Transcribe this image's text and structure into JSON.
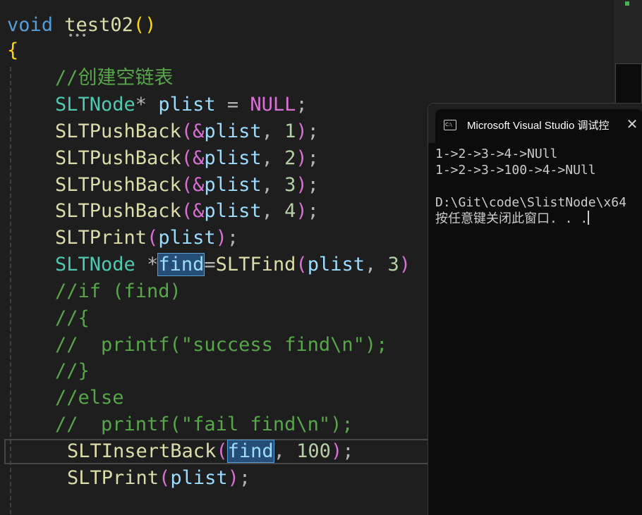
{
  "editor": {
    "signature": {
      "keyword": "void",
      "name": "test02",
      "parens": "()"
    },
    "open_brace": "{",
    "code": {
      "comment_create": "//创建空链表",
      "decl": {
        "type": "SLTNode",
        "star": "*",
        "var": "plist",
        "op": "=",
        "value": "NULL",
        "semi": ";"
      },
      "push1": {
        "fn": "SLTPushBack",
        "amp": "(&",
        "var": "plist",
        "comma": ",",
        "num": "1",
        "close": ")",
        "semi": ";"
      },
      "push2": {
        "fn": "SLTPushBack",
        "amp": "(&",
        "var": "plist",
        "comma": ",",
        "num": "2",
        "close": ")",
        "semi": ";"
      },
      "push3": {
        "fn": "SLTPushBack",
        "amp": "(&",
        "var": "plist",
        "comma": ",",
        "num": "3",
        "close": ")",
        "semi": ";"
      },
      "push4": {
        "fn": "SLTPushBack",
        "amp": "(&",
        "var": "plist",
        "comma": ",",
        "num": "4",
        "close": ")",
        "semi": ";"
      },
      "print1": {
        "fn": "SLTPrint",
        "open": "(",
        "var": "plist",
        "close": ")",
        "semi": ";"
      },
      "find": {
        "type": "SLTNode",
        "star": "*",
        "var": "find",
        "op": "=",
        "fn": "SLTFind",
        "open": "(",
        "arg": "plist",
        "comma": ",",
        "num": "3",
        "close": ")"
      },
      "c_if": "//if (find)",
      "c_open": "//{",
      "c_printf_success": "//  printf(\"success find\\n\");",
      "c_close": "//}",
      "c_else": "//else",
      "c_printf_fail": "//  printf(\"fail find\\n\");",
      "insert": {
        "fn": "SLTInsertBack",
        "open": "(",
        "var": "find",
        "comma": ",",
        "num": "100",
        "close": ")",
        "semi": ";"
      },
      "print2": {
        "fn": "SLTPrint",
        "open": "(",
        "var": "plist",
        "close": ")",
        "semi": ";"
      }
    }
  },
  "console": {
    "icon": "C:\\",
    "title": "Microsoft Visual Studio 调试控",
    "close": "✕",
    "lines": [
      "1->2->3->4->NUll",
      "1->2->3->100->4->NUll",
      "",
      "D:\\Git\\code\\SlistNode\\x64",
      "按任意键关闭此窗口. . ."
    ]
  },
  "colors": {
    "background": "#1e1e1e",
    "keyword": "#569cd6",
    "function": "#dcdcaa",
    "type": "#4ec9b0",
    "variable": "#9cdcfe",
    "number": "#b5cea8",
    "string": "#ce9178",
    "comment": "#57a64a",
    "console_bg": "#0c0c0c",
    "selection": "#264f78"
  }
}
